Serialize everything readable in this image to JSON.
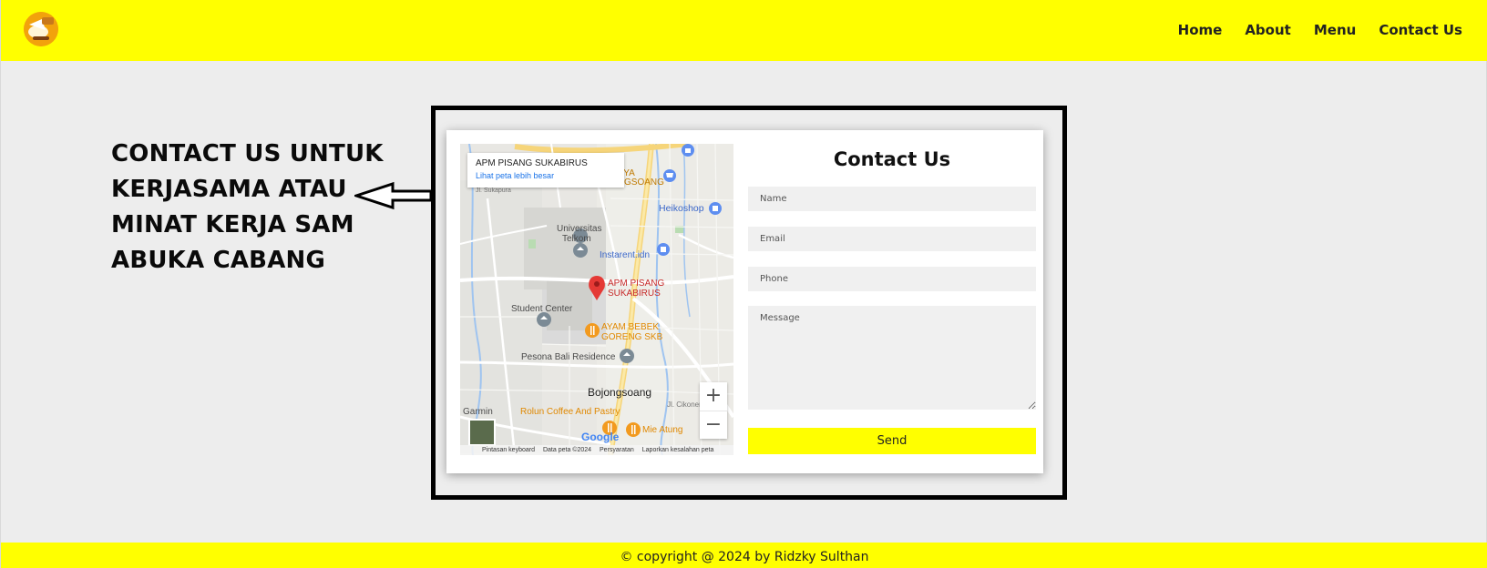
{
  "nav": {
    "links": [
      "Home",
      "About",
      "Menu",
      "Contact Us"
    ]
  },
  "side_text": {
    "lines": [
      "CONTACT US UNTUK",
      "KERJASAMA ATAU",
      "MINAT KERJA SAM",
      "ABUKA CABANG"
    ]
  },
  "map": {
    "place_title": "APM PISANG SUKABIRUS",
    "link_text": "Lihat peta lebih besar",
    "labels": {
      "yogya": "YOGYA",
      "gsoang": "GSOANG",
      "heikoshop": "Heikoshop",
      "universitas": "Universitas",
      "telkom": "Telkom",
      "instarent": "Instarent.idn",
      "pin1": "APM PISANG",
      "pin2": "SUKABIRUS",
      "student": "Student Center",
      "ayam1": "AYAM BEBEK",
      "ayam2": "GORENG SKB",
      "pesona": "Pesona Bali Residence",
      "bojong": "Bojongsoang",
      "garmin": "Garmin",
      "rolun": "Rolun Coffee And Pastry",
      "mie": "Mie Atung",
      "sukapura": "Jl. Sukapura",
      "cikoneng": "Jl. Cikoneng"
    },
    "zoom_in": "+",
    "zoom_out": "−",
    "google": "Google",
    "footer": [
      "Pintasan keyboard",
      "Data peta ©2024",
      "Persyaratan",
      "Laporkan kesalahan peta"
    ]
  },
  "form": {
    "title": "Contact Us",
    "name_placeholder": "Name",
    "email_placeholder": "Email",
    "phone_placeholder": "Phone",
    "message_placeholder": "Message",
    "send_label": "Send"
  },
  "footer": {
    "text": "© copyright @ 2024 by Ridzky Sulthan"
  },
  "colors": {
    "accent": "#ffff00",
    "background": "#ededed"
  }
}
